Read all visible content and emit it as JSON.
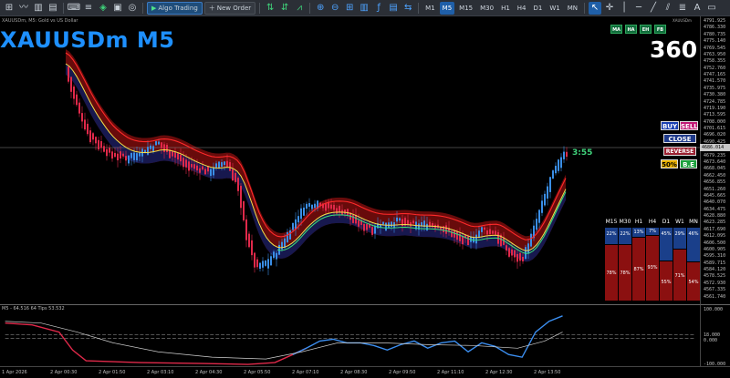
{
  "toolbar": {
    "algo_trading": "Algo Trading",
    "new_order": "New Order",
    "timeframes": [
      "M1",
      "M5",
      "M15",
      "M30",
      "H1",
      "H4",
      "D1",
      "W1",
      "MN"
    ],
    "active_timeframe": "M5"
  },
  "chart": {
    "info": "XAUUSDm, M5:  Gold vs US Dollar",
    "title": "XAUUSDm M5",
    "countdown": "3:55",
    "big_number": "360",
    "top_right_label": "XAUUSDm"
  },
  "badges": [
    "MA",
    "HA",
    "EH",
    "FB"
  ],
  "trade_panel": {
    "buy": "BUY",
    "sell": "SELL",
    "close": "CLOSE",
    "reverse": "REVERSE",
    "fifty": "50%",
    "be": "B.E"
  },
  "price_axis": {
    "ticks": [
      "4791.925",
      "4786.330",
      "4780.735",
      "4775.140",
      "4769.545",
      "4763.950",
      "4758.355",
      "4752.760",
      "4747.165",
      "4741.570",
      "4735.975",
      "4730.380",
      "4724.785",
      "4719.190",
      "4713.595",
      "4708.000",
      "4701.615",
      "4696.020",
      "4690.425",
      "4684.830",
      "4679.235",
      "4673.640",
      "4668.045",
      "4662.450",
      "4656.855",
      "4651.260",
      "4645.665",
      "4640.070",
      "4634.475",
      "4628.880",
      "4623.285",
      "4617.690",
      "4612.095",
      "4606.500",
      "4600.905",
      "4595.310",
      "4589.715",
      "4584.120",
      "4578.525",
      "4572.930",
      "4567.335",
      "4561.740"
    ],
    "current": "4686.014"
  },
  "strength": {
    "headers": [
      "M15",
      "M30",
      "H1",
      "H4",
      "D1",
      "W1",
      "MN"
    ],
    "buy": [
      "22%",
      "22%",
      "13%",
      "7%",
      "45%",
      "29%",
      "46%"
    ],
    "sell": [
      "78%",
      "78%",
      "87%",
      "93%",
      "55%",
      "71%",
      "54%"
    ],
    "buy_values": [
      22,
      22,
      13,
      7,
      45,
      29,
      46
    ]
  },
  "indicator": {
    "label": "M5 - 64.516 64 Tips 53.532",
    "ticks": [
      "100.000",
      "18.000",
      "0.000",
      "-100.000"
    ]
  },
  "time_axis": {
    "labels": [
      "1 Apr 2026",
      "2 Apr 00:30",
      "2 Apr 01:50",
      "2 Apr 03:10",
      "2 Apr 04:30",
      "2 Apr 05:50",
      "2 Apr 07:10",
      "2 Apr 08:30",
      "2 Apr 09:50",
      "2 Apr 11:10",
      "2 Apr 12:30",
      "2 Apr 13:50"
    ]
  },
  "colors": {
    "bull": "#3a8ee6",
    "bear": "#e0294a",
    "red_band": "#7a0d0d",
    "blue_band": "#0e1a55",
    "yellow": "#f4e04a",
    "green": "#3be07a",
    "red_line": "#ff2a2a"
  }
}
